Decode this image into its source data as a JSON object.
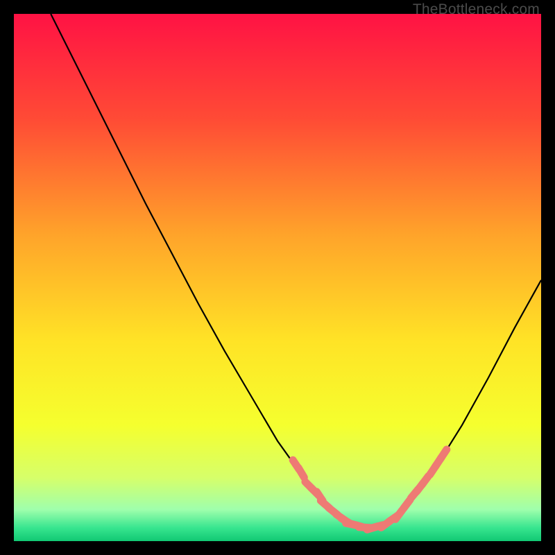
{
  "watermark": "TheBottleneck.com",
  "chart_data": {
    "type": "line",
    "title": "",
    "xlabel": "",
    "ylabel": "",
    "xlim": [
      0,
      100
    ],
    "ylim": [
      0,
      100
    ],
    "series": [
      {
        "name": "curve",
        "x": [
          7,
          10,
          15,
          20,
          25,
          30,
          35,
          40,
          45,
          50,
          55,
          58,
          60,
          63,
          65,
          68,
          70,
          73,
          75,
          80,
          85,
          90,
          95,
          100
        ],
        "y": [
          100,
          94,
          84,
          74,
          64,
          54.5,
          45,
          36,
          27.5,
          19,
          12,
          8.5,
          6.5,
          4,
          3,
          2.5,
          3,
          5,
          7.5,
          14,
          22,
          31,
          40.5,
          49.5
        ]
      }
    ],
    "markers": {
      "name": "segments",
      "color": "#ee7a74",
      "points": [
        {
          "x": 53.5,
          "y": 14.5
        },
        {
          "x": 54.5,
          "y": 13
        },
        {
          "x": 56.0,
          "y": 10.5
        },
        {
          "x": 57.0,
          "y": 9.5
        },
        {
          "x": 58.0,
          "y": 8.5
        },
        {
          "x": 59.0,
          "y": 7.0
        },
        {
          "x": 60.5,
          "y": 5.7
        },
        {
          "x": 62.0,
          "y": 4.5
        },
        {
          "x": 63.0,
          "y": 3.8
        },
        {
          "x": 64.0,
          "y": 3.2
        },
        {
          "x": 65.0,
          "y": 3.0
        },
        {
          "x": 66.5,
          "y": 2.6
        },
        {
          "x": 68.0,
          "y": 2.5
        },
        {
          "x": 69.0,
          "y": 2.8
        },
        {
          "x": 70.5,
          "y": 3.2
        },
        {
          "x": 72.0,
          "y": 4.3
        },
        {
          "x": 73.0,
          "y": 5.0
        },
        {
          "x": 74.5,
          "y": 7.0
        },
        {
          "x": 76.0,
          "y": 9.0
        },
        {
          "x": 77.0,
          "y": 10.2
        },
        {
          "x": 78.0,
          "y": 11.5
        },
        {
          "x": 79.5,
          "y": 13.5
        },
        {
          "x": 80.5,
          "y": 15.0
        },
        {
          "x": 81.5,
          "y": 16.5
        }
      ]
    },
    "gradient_stops": [
      {
        "offset": 0.0,
        "color": "#ff1244"
      },
      {
        "offset": 0.2,
        "color": "#ff4b35"
      },
      {
        "offset": 0.42,
        "color": "#ffa42a"
      },
      {
        "offset": 0.62,
        "color": "#ffe326"
      },
      {
        "offset": 0.78,
        "color": "#f5ff2e"
      },
      {
        "offset": 0.88,
        "color": "#d6ff6a"
      },
      {
        "offset": 0.94,
        "color": "#9fffac"
      },
      {
        "offset": 0.975,
        "color": "#37e58f"
      },
      {
        "offset": 1.0,
        "color": "#11c873"
      }
    ]
  }
}
